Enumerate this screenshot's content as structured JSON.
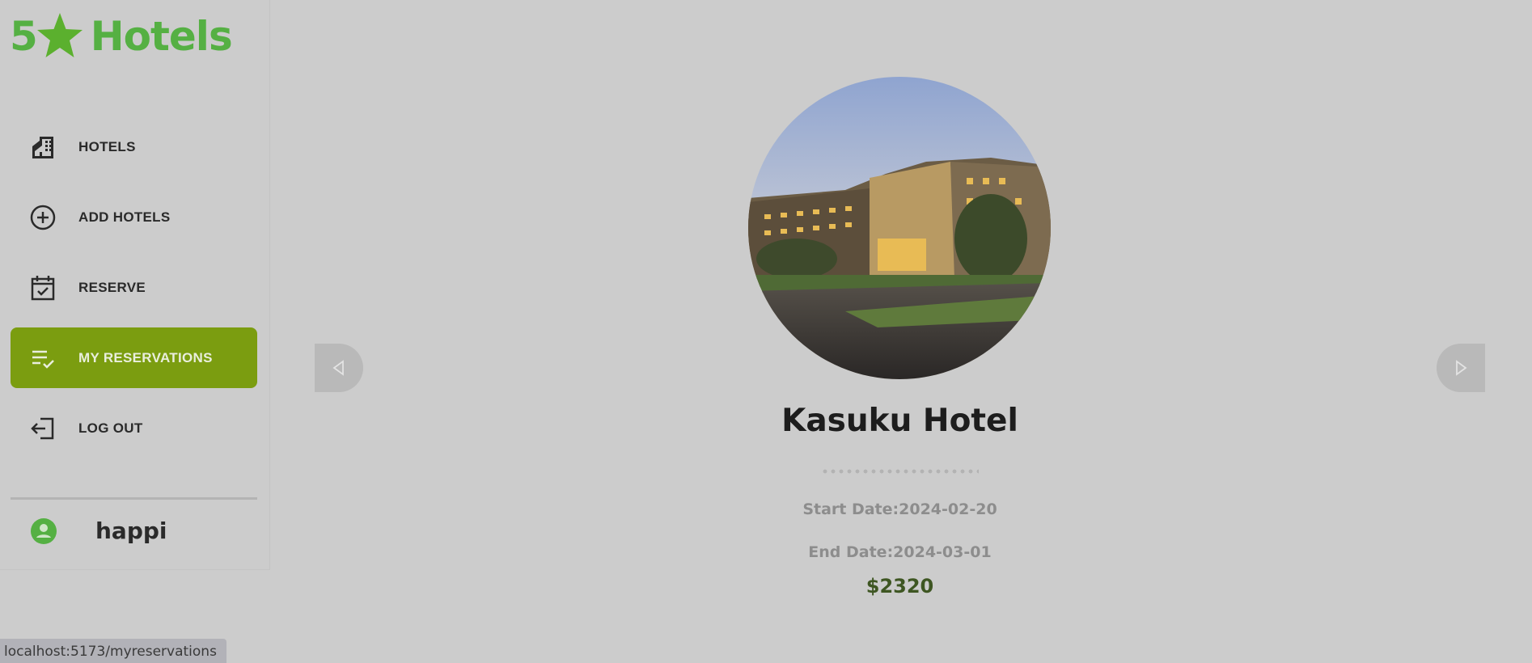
{
  "brand": {
    "number": "5",
    "name": "Hotels",
    "star_icon": "star-icon",
    "color": "#55b043"
  },
  "nav": {
    "items": [
      {
        "label": "HOTELS",
        "icon": "building-icon",
        "active": false
      },
      {
        "label": "ADD HOTELS",
        "icon": "plus-circle-icon",
        "active": false
      },
      {
        "label": "RESERVE",
        "icon": "calendar-check-icon",
        "active": false
      },
      {
        "label": "MY RESERVATIONS",
        "icon": "list-check-icon",
        "active": true
      },
      {
        "label": "LOG OUT",
        "icon": "logout-icon",
        "active": false
      }
    ],
    "active_color": "#7b9d10"
  },
  "user": {
    "name": "happi",
    "icon": "user-circle-icon"
  },
  "reservation": {
    "hotel_name": "Kasuku Hotel",
    "start_date": "Start Date:2024-02-20",
    "end_date": "End Date:2024-03-01",
    "price": "$2320"
  },
  "carousel": {
    "prev_icon": "triangle-left-icon",
    "next_icon": "triangle-right-icon"
  },
  "status_bar": {
    "url": "localhost:5173/myreservations"
  }
}
